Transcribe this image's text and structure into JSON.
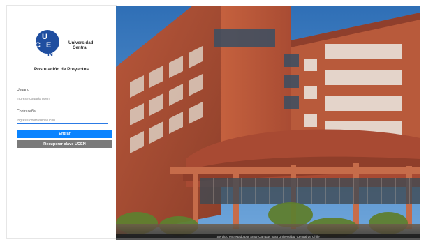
{
  "brand": {
    "letters": [
      "U",
      "C",
      "E",
      "N"
    ],
    "name_line1": "Universidad",
    "name_line2": "Central",
    "logo_color": "#1f4ea0"
  },
  "app": {
    "title": "Postulación de Proyectos"
  },
  "form": {
    "user_label": "Usuario",
    "user_placeholder": "Ingrese usuario ucen",
    "password_label": "Contraseña",
    "password_placeholder": "Ingrese contraseña ucen",
    "submit_label": "Entrar",
    "recover_label": "Recuperar clave UCEN"
  },
  "footer": {
    "text": "Servicio entregado por SmartCampus para Universidad Central de Chile"
  },
  "colors": {
    "primary": "#0a84ff",
    "secondary": "#7a7a7a",
    "underline": "#2c7be5"
  }
}
